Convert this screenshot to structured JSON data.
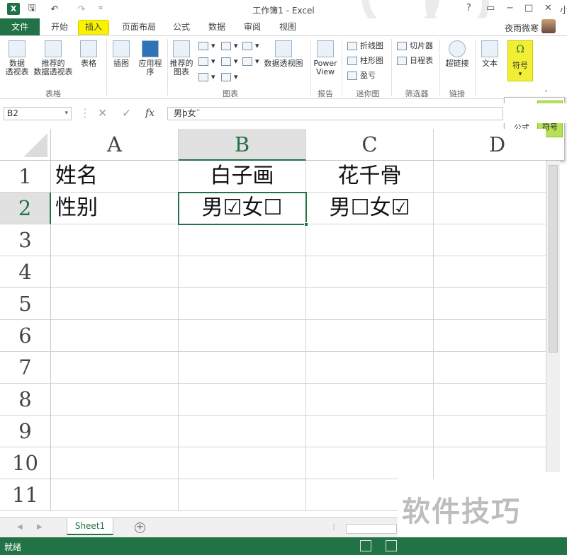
{
  "window": {
    "title": "工作簿1 - Excel",
    "help": "?",
    "minimize": "−",
    "restore": "□",
    "close": "✕",
    "user": "夜雨微寒",
    "partial_text": "小"
  },
  "quick_access": {
    "logo": "X",
    "save": "🖫",
    "undo": "↶",
    "redo": "↷",
    "customize": "⁼"
  },
  "tabs": [
    "文件",
    "开始",
    "插入",
    "页面布局",
    "公式",
    "数据",
    "审阅",
    "视图"
  ],
  "ribbon": {
    "pivot_table": "数据\n透视表",
    "pivot_table_l1": "数据",
    "pivot_table_l2": "透视表",
    "recommended_pivot_l1": "推荐的",
    "recommended_pivot_l2": "数据透视表",
    "table": "表格",
    "illustrations": "插图",
    "apps_l1": "应用程",
    "apps_l2": "序",
    "recommended_charts_l1": "推荐的",
    "recommended_charts_l2": "图表",
    "pivot_chart": "数据透视图",
    "power_view_l1": "Power",
    "power_view_l2": "View",
    "sparkline_line": "折线图",
    "sparkline_column": "柱形图",
    "sparkline_winloss": "盈亏",
    "slicer": "切片器",
    "timeline": "日程表",
    "hyperlink": "超链接",
    "text": "文本",
    "symbols": "符号",
    "symbols_glyph": "Ω",
    "groups": {
      "tables": "表格",
      "charts": "图表",
      "reports": "报告",
      "sparklines": "迷你图",
      "filters": "筛选器",
      "links": "链接"
    }
  },
  "symbols_popup": {
    "equation_glyph": "π",
    "equation_label": "公式",
    "symbol_glyph": "Ω",
    "symbol_label": "符号",
    "group_label": "符号"
  },
  "formula_bar": {
    "name_box": "B2",
    "cancel": "✕",
    "enter": "✓",
    "fx": "fx",
    "content": "男þ女¨"
  },
  "grid": {
    "columns": [
      "A",
      "B",
      "C",
      "D"
    ],
    "rows": [
      "1",
      "2",
      "3",
      "4",
      "5",
      "6",
      "7",
      "8",
      "9",
      "10",
      "11"
    ],
    "cells": {
      "A1": "姓名",
      "B1": "白子画",
      "C1": "花千骨",
      "A2": "性别",
      "B2": "男☑女☐",
      "C2": "男☐女☑"
    },
    "selected_cell": "B2"
  },
  "sheet_tabs": {
    "active": "Sheet1",
    "add": "+"
  },
  "status": {
    "ready": "就绪"
  },
  "watermark": "软件技巧"
}
